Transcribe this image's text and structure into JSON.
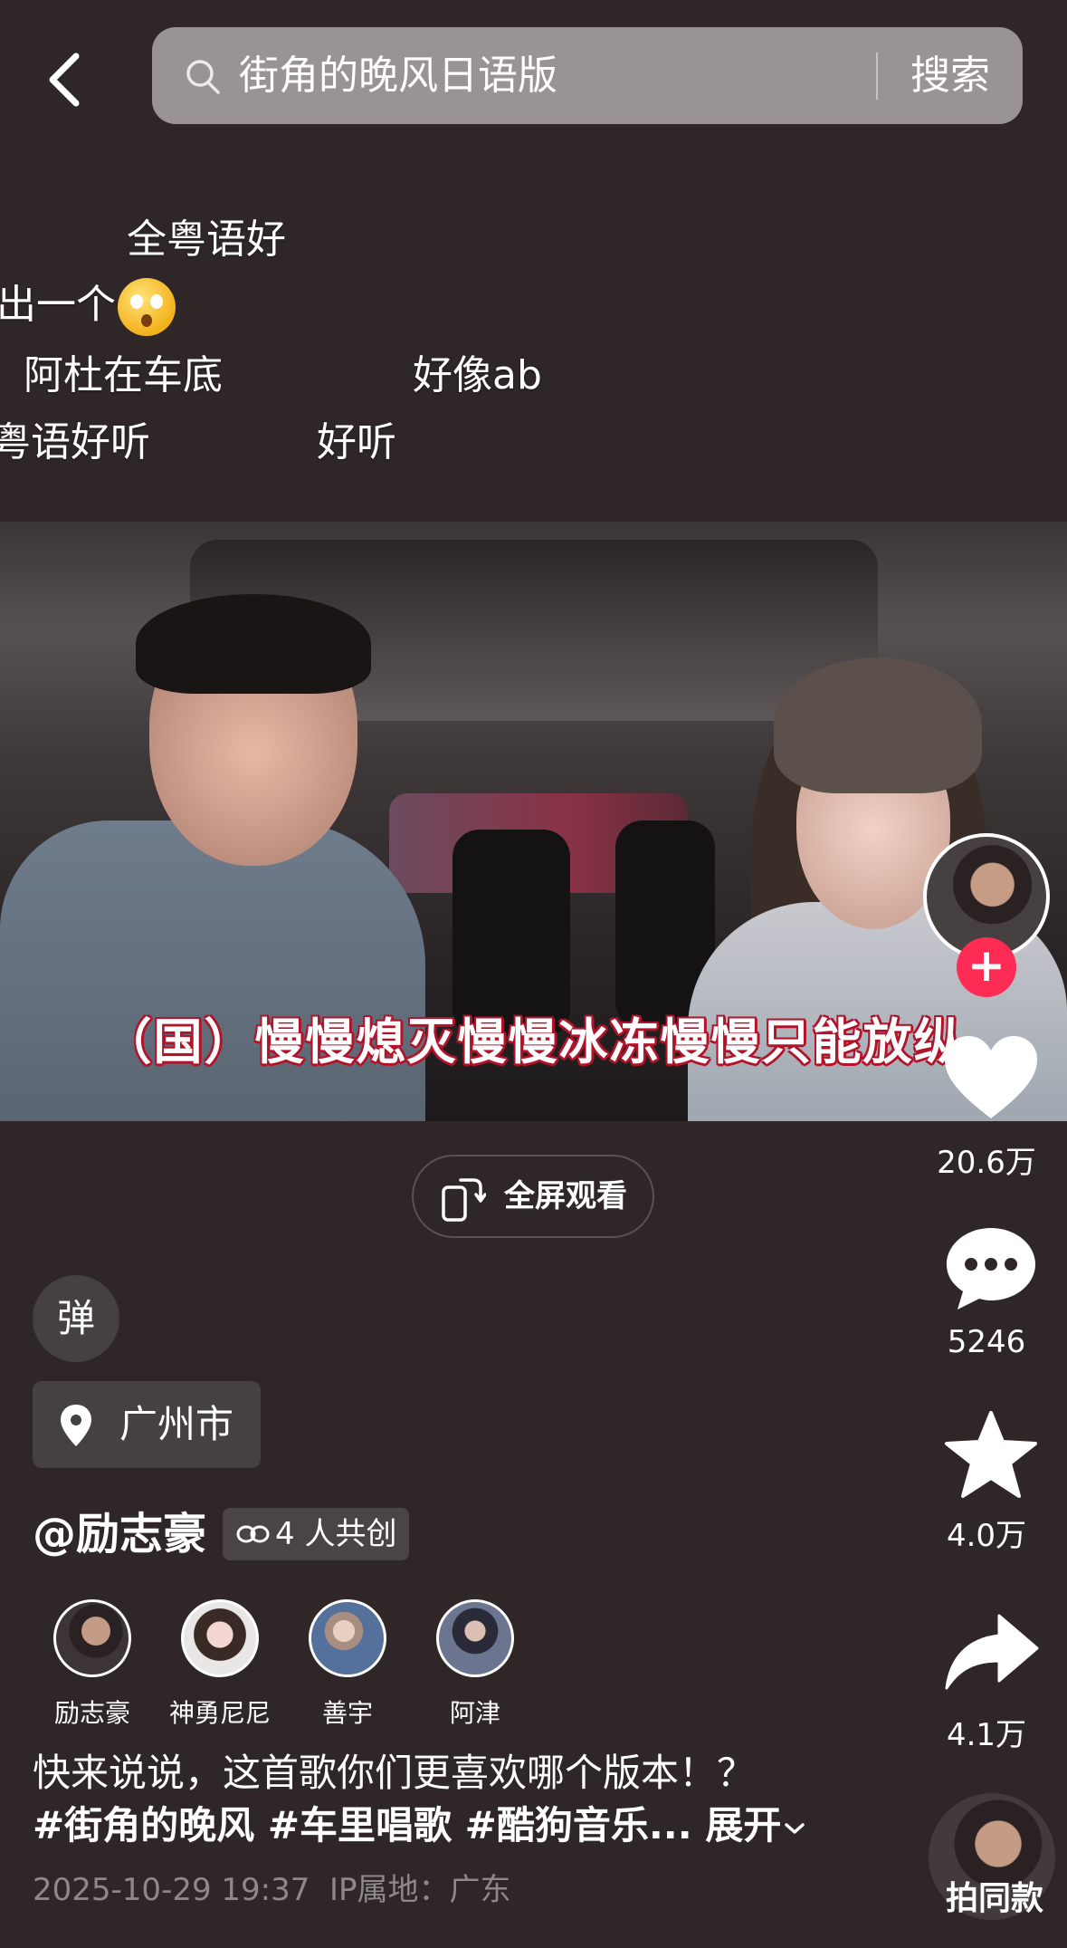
{
  "search": {
    "query": "街角的晚风日语版",
    "button_label": "搜索"
  },
  "danmaku": [
    {
      "text": "全粤语好"
    },
    {
      "text": "出一个"
    },
    {
      "text": "阿杜在车底"
    },
    {
      "text": "好像ab"
    },
    {
      "text": "粤语好听"
    },
    {
      "text": "好听"
    }
  ],
  "video": {
    "subtitle": "（国）慢慢熄灭慢慢冰冻慢慢只能放纵"
  },
  "fullscreen": {
    "label": "全屏观看"
  },
  "actions": {
    "likes": "20.6万",
    "comments": "5246",
    "favorites": "4.0万",
    "shares": "4.1万"
  },
  "danmaku_toggle": {
    "label": "弹"
  },
  "location": {
    "label": "广州市"
  },
  "author": {
    "name": "@励志豪",
    "cocreate": "4 人共创"
  },
  "creators": [
    {
      "name": "励志豪"
    },
    {
      "name": "神勇尼尼"
    },
    {
      "name": "善宇"
    },
    {
      "name": "阿津"
    }
  ],
  "description": {
    "line1": "快来说说，这首歌你们更喜欢哪个版本！？",
    "line2": "#街角的晚风 #车里唱歌 #酷狗音乐...",
    "expand": "展开"
  },
  "meta": {
    "datetime": "2025-10-29 19:37",
    "ip": "IP属地：广东"
  },
  "same_style": {
    "label": "拍同款"
  },
  "colors": {
    "background": "#2e2627",
    "accent": "#fe2c55",
    "subtitle_outline": "#b3142a"
  }
}
